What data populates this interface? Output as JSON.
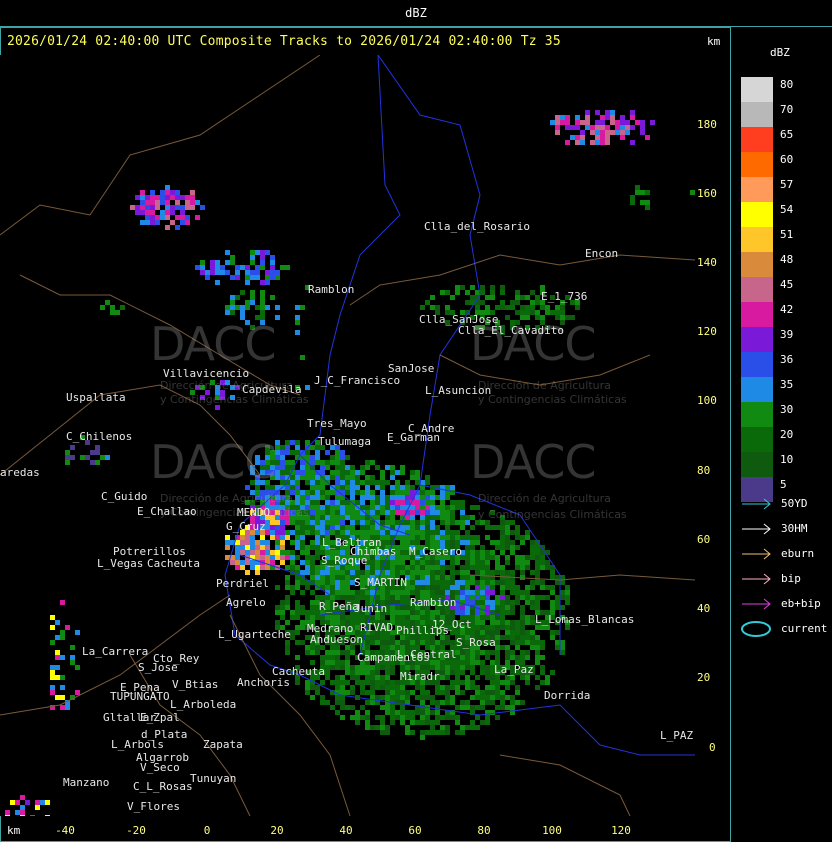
{
  "header": {
    "title": "dBZ"
  },
  "map": {
    "subtitle": "2026/01/24 02:40:00 UTC Composite Tracks to 2026/01/24 02:40:00 Tz 35",
    "km_top": "km",
    "km_bottom": "km",
    "x_ticks": [
      "-40",
      "-20",
      "0",
      "20",
      "40",
      "60",
      "80",
      "100",
      "120"
    ],
    "y_ticks": [
      "180",
      "160",
      "140",
      "120",
      "100",
      "80",
      "60",
      "40",
      "20",
      "0"
    ],
    "watermark": {
      "brand": "DACC",
      "line1": "Dirección de Agricultura",
      "line2": "y Contingencias Climáticas"
    },
    "places": [
      "Clla_del_Rosario",
      "Encon",
      "Ramblon",
      "E_1_736",
      "Clla_SanJose",
      "Clla_El_Cavadito",
      "Villavicencio",
      "Capdevila",
      "J_C_Francisco",
      "SanJose",
      "L_Asuncion",
      "Uspallata",
      "Tres_Mayo",
      "Tulumaga",
      "C_Andre",
      "E_Garman",
      "C_Chilenos",
      "aredas",
      "C_Guido",
      "E_Challao",
      "MENDO",
      "G_Cruz",
      "L_Beltran",
      "Chimbas",
      "M_Casero",
      "S_Roque",
      "Rivad",
      "Potrerillos",
      "Cacheuta",
      "L_Vegas",
      "Perdriel",
      "Agrelo",
      "S_MARTIN",
      "R_Peña",
      "Junin",
      "Rambion",
      "Phillips",
      "L_Ugarteche",
      "Medrano",
      "Andueson",
      "RIVAD",
      "12_Oct",
      "S_Rosa",
      "L_Lomas_Blancas",
      "La_Carrera",
      "Cto_Rey",
      "S_Jose",
      "Campamentos",
      "L_Central",
      "E_Pena",
      "TUPUNGATO",
      "V_Btias",
      "Anchoris",
      "Cacheuta",
      "Miradr",
      "La_Paz",
      "Dorrida",
      "L_Arboleda",
      "Gltallar",
      "E_Zpal",
      "d_Plata",
      "Zapata",
      "L_Arbols",
      "Algarrob",
      "V_Seco",
      "Tunuyan",
      "Manzano",
      "C_L_Rosas",
      "V_Flores",
      "L_PAZ"
    ]
  },
  "scale": {
    "title": "dBZ",
    "entries": [
      {
        "label": "80",
        "color": "#d6d6d6"
      },
      {
        "label": "70",
        "color": "#b8b8b8"
      },
      {
        "label": "65",
        "color": "#ff3e1f"
      },
      {
        "label": "60",
        "color": "#ff6a00"
      },
      {
        "label": "57",
        "color": "#ff9a5a"
      },
      {
        "label": "54",
        "color": "#ffff00"
      },
      {
        "label": "51",
        "color": "#ffc62a"
      },
      {
        "label": "48",
        "color": "#d98a3a"
      },
      {
        "label": "45",
        "color": "#c8658a"
      },
      {
        "label": "42",
        "color": "#d81aa0"
      },
      {
        "label": "39",
        "color": "#7a1ad8"
      },
      {
        "label": "36",
        "color": "#2a4ee8"
      },
      {
        "label": "35",
        "color": "#1e8ae6"
      },
      {
        "label": "30",
        "color": "#118a11"
      },
      {
        "label": "20",
        "color": "#0a6a0a"
      },
      {
        "label": "10",
        "color": "#0e5a0e"
      },
      {
        "label": "5",
        "color": "#4b3a8a"
      }
    ]
  },
  "legend": [
    {
      "label": "50YD",
      "color": "#35c8d8",
      "icon": "cyan-arrow-icon"
    },
    {
      "label": "30HM",
      "color": "#ffffff",
      "icon": "white-arrow-icon"
    },
    {
      "label": "eburn",
      "color": "#f0c070",
      "icon": "orange-arrow-icon"
    },
    {
      "label": "bip",
      "color": "#ffb0c0",
      "icon": "pink-arrow-icon"
    },
    {
      "label": "eb+bip",
      "color": "#e040e0",
      "icon": "magenta-arrow-icon"
    },
    {
      "label": "current",
      "color": "#35c8d8",
      "icon": "ellipse-icon"
    }
  ]
}
